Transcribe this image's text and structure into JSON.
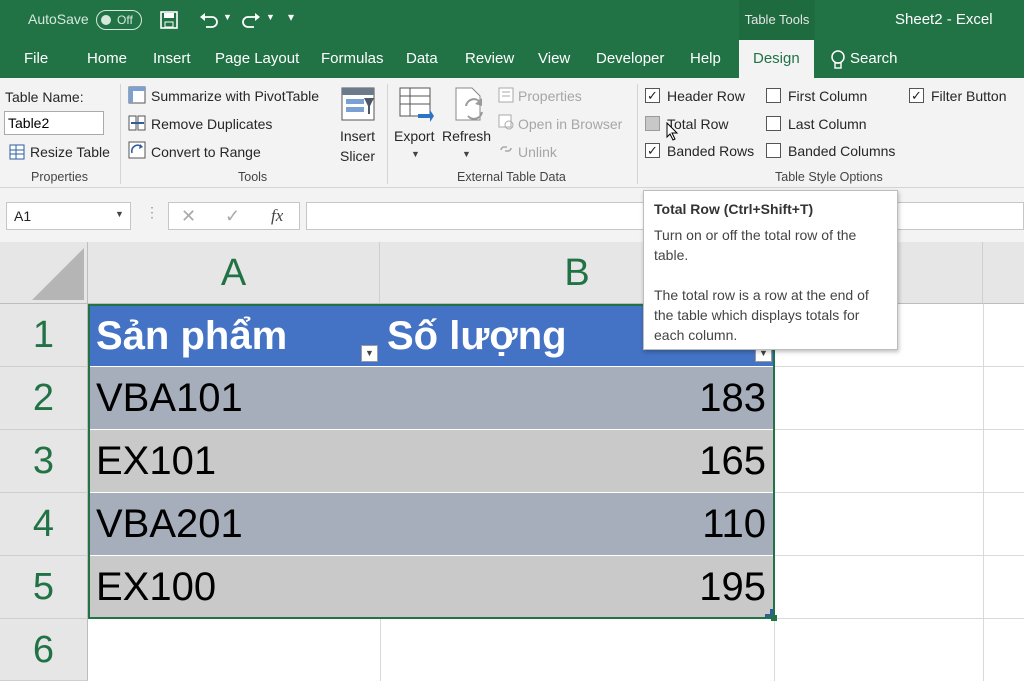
{
  "titlebar": {
    "autosave": "AutoSave",
    "autosave_state": "Off",
    "context": "Table Tools",
    "title": "Sheet2  -  Excel"
  },
  "tabs": [
    "File",
    "Home",
    "Insert",
    "Page Layout",
    "Formulas",
    "Data",
    "Review",
    "View",
    "Developer",
    "Help",
    "Design"
  ],
  "search": "Search",
  "ribbon": {
    "properties": {
      "table_name_label": "Table Name:",
      "table_name_value": "Table2",
      "resize": "Resize Table",
      "group": "Properties"
    },
    "tools": {
      "pivot": "Summarize with PivotTable",
      "dupes": "Remove Duplicates",
      "convert": "Convert to Range",
      "slicer_1": "Insert",
      "slicer_2": "Slicer",
      "group": "Tools"
    },
    "external": {
      "export": "Export",
      "refresh": "Refresh",
      "props": "Properties",
      "open": "Open in Browser",
      "unlink": "Unlink",
      "group": "External Table Data"
    },
    "style_options": {
      "header_row": "Header Row",
      "total_row": "Total Row",
      "banded_rows": "Banded Rows",
      "first_col": "First Column",
      "last_col": "Last Column",
      "banded_cols": "Banded Columns",
      "filter": "Filter Button",
      "group": "Table Style Options"
    }
  },
  "formula_bar": {
    "name_box": "A1",
    "fx": "fx"
  },
  "columns": [
    "A",
    "B"
  ],
  "rows": [
    "1",
    "2",
    "3",
    "4",
    "5",
    "6"
  ],
  "table": {
    "headers": [
      "Sản phẩm",
      "Số lượng"
    ],
    "data": [
      [
        "VBA101",
        "183"
      ],
      [
        "EX101",
        "165"
      ],
      [
        "VBA201",
        "110"
      ],
      [
        "EX100",
        "195"
      ]
    ]
  },
  "tooltip": {
    "title": "Total Row (Ctrl+Shift+T)",
    "line1": "Turn on or off the total row of the table.",
    "line2": "The total row is a row at the end of the table which displays totals for each column."
  },
  "colors": {
    "brand": "#217346",
    "header_fill": "#4472c4",
    "band_dark": "#a6aebb",
    "band_light": "#c9c9c9"
  }
}
